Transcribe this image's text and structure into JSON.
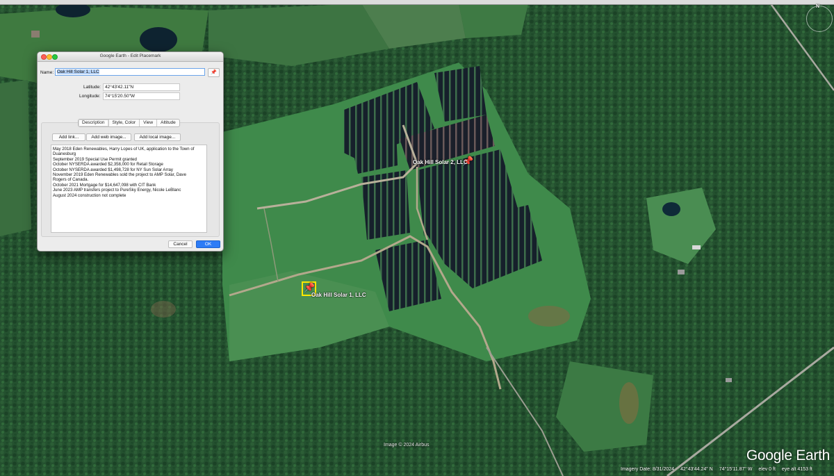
{
  "dialog": {
    "window_title": "Google Earth - Edit Placemark",
    "name_label": "Name:",
    "name_value": "Oak Hill Solar 1, LLC",
    "latitude_label": "Latitude:",
    "latitude_value": "42°43'42.11\"N",
    "longitude_label": "Longitude:",
    "longitude_value": "74°15'20.50\"W",
    "tabs": [
      {
        "label": "Description",
        "active": true
      },
      {
        "label": "Style, Color"
      },
      {
        "label": "View"
      },
      {
        "label": "Altitude"
      }
    ],
    "buttons": {
      "add_link": "Add link...",
      "add_web_image": "Add web image...",
      "add_local_image": "Add local image...",
      "cancel": "Cancel",
      "ok": "OK"
    },
    "description_lines": [
      "May 2018 Eden Renewables, Harry Lopes of UK, application to the Town of",
      "Duanesburg",
      "September 2019 Special Use Permit granted",
      "October NYSERDA awarded $2,358,000 for Retail Storage",
      "October NYSERDA awarded $1,498,728 for NY Sun Solar Array",
      "November 2019 Eden Renewables sold the project to AMP Solar, Dave",
      "Rogers of Canada.",
      "October 2021 Mortgage for $14,647,098 with CIT Bank",
      "June 2023 AMP transfers project to PureSky Energy, Nicole LeBlanc",
      "August 2024 construction not complete"
    ]
  },
  "map": {
    "placemarks": [
      {
        "label": "Oak Hill Solar 2, LLC"
      },
      {
        "label": "Oak Hill Solar 1, LLC"
      }
    ],
    "credit": "Image © 2024 Airbus",
    "logo": "Google Earth",
    "status": {
      "imagery_date": "Imagery Date: 8/31/2024",
      "lat": "42°43'44.24\" N",
      "lon": "74°15'11.87\" W",
      "elev": "elev 0 ft",
      "eye_alt": "eye alt 4153 ft"
    },
    "compass_n": "N"
  },
  "colors": {
    "accent": "#2d7cf6",
    "pin": "#ffe21a",
    "forest": "#1f4a2c",
    "field": "#3e7d45"
  }
}
